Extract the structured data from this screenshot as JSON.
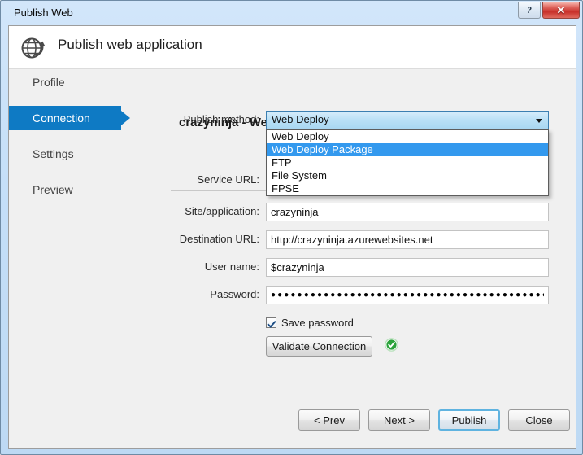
{
  "window": {
    "title": "Publish Web",
    "help_button": "?",
    "close_button": "✕"
  },
  "header": {
    "icon": "globe-publish-icon",
    "title": "Publish web application"
  },
  "sidebar": {
    "items": [
      {
        "label": "Profile",
        "selected": false
      },
      {
        "label": "Connection",
        "selected": true
      },
      {
        "label": "Settings",
        "selected": false
      },
      {
        "label": "Preview",
        "selected": false
      }
    ]
  },
  "panel": {
    "title": "crazyninja - Web Deploy *",
    "publish_method": {
      "label": "Publish method:",
      "value": "Web Deploy",
      "options": [
        {
          "label": "Web Deploy",
          "highlighted": false
        },
        {
          "label": "Web Deploy Package",
          "highlighted": true
        },
        {
          "label": "FTP",
          "highlighted": false
        },
        {
          "label": "File System",
          "highlighted": false
        },
        {
          "label": "FPSE",
          "highlighted": false
        }
      ]
    },
    "fields": [
      {
        "label": "Service URL:",
        "value": ""
      },
      {
        "label": "Site/application:",
        "value": "crazyninja"
      },
      {
        "label": "Destination URL:",
        "value": "http://crazyninja.azurewebsites.net"
      },
      {
        "label": "User name:",
        "value": "$crazyninja"
      }
    ],
    "password": {
      "label": "Password:",
      "value": "●●●●●●●●●●●●●●●●●●●●●●●●●●●●●●●●●●●●●●●●●●●●●●●●●●●●●●●●●●●●●●●●●●"
    },
    "save_password": {
      "label": "Save password",
      "checked": true
    },
    "validate_button": "Validate Connection",
    "validate_status_icon": "green-check-icon"
  },
  "footer": {
    "prev": "< Prev",
    "next": "Next >",
    "publish": "Publish",
    "close": "Close"
  },
  "colors": {
    "accent": "#0e7ac4",
    "highlight": "#3399ee",
    "success": "#2aa33a",
    "close_red": "#c8302a"
  }
}
